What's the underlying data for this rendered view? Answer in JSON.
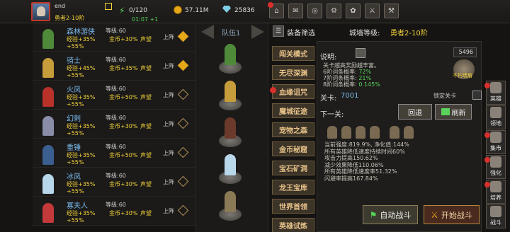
{
  "player": {
    "name": "end",
    "rank": "勇者2-10阶",
    "stamina": "0/120",
    "timer": "01:07 +1",
    "gold": "57.11M",
    "diamonds": "25836"
  },
  "top_buttons": [
    {
      "icon": "shop-icon",
      "glyph": "⌂",
      "dot": true
    },
    {
      "icon": "mail-icon",
      "glyph": "✉",
      "dot": false
    },
    {
      "icon": "gamepad-icon",
      "glyph": "◎",
      "dot": false
    },
    {
      "icon": "settings-icon",
      "glyph": "⚙",
      "dot": false
    },
    {
      "icon": "wheel-icon",
      "glyph": "✿",
      "dot": false
    },
    {
      "icon": "sword-icon",
      "glyph": "⚔",
      "dot": false
    },
    {
      "icon": "axe-icon",
      "glyph": "⚒",
      "dot": false
    }
  ],
  "heroes": [
    {
      "name": "森林游侠",
      "level": "等级:60",
      "exp": "经验+35%",
      "gold": "金币+30%",
      "fame": "声望",
      "extra": "+55%",
      "deploy": "上阵",
      "deployed": true,
      "color": "#4f8a3a"
    },
    {
      "name": "骑士",
      "level": "等级:60",
      "exp": "经验+45%",
      "gold": "金币+35%",
      "fame": "声望",
      "extra": "+55%",
      "deploy": "上阵",
      "deployed": true,
      "color": "#c79c3a"
    },
    {
      "name": "火凤",
      "level": "等级:60",
      "exp": "经验+35%",
      "gold": "金币+50%",
      "fame": "声望",
      "extra": "+55%",
      "deploy": "上阵",
      "deployed": false,
      "color": "#b8322a"
    },
    {
      "name": "幻刺",
      "level": "等级:60",
      "exp": "经验+35%",
      "gold": "金币+30%",
      "fame": "声望",
      "extra": "+55%",
      "deploy": "上阵",
      "deployed": false,
      "color": "#8a8ca8"
    },
    {
      "name": "重锤",
      "level": "等级:60",
      "exp": "经验+35%",
      "gold": "金币+50%",
      "fame": "声望",
      "extra": "+55%",
      "deploy": "上阵",
      "deployed": false,
      "color": "#3b5f8f"
    },
    {
      "name": "冰凤",
      "level": "等级:60",
      "exp": "经验+35%",
      "gold": "金币+30%",
      "fame": "声望",
      "extra": "+55%",
      "deploy": "上阵",
      "deployed": false,
      "color": "#b9d7ea"
    },
    {
      "name": "寡夫人",
      "level": "等级:60",
      "exp": "经验+35%",
      "gold": "金币+30%",
      "fame": "声望",
      "extra": "+55%",
      "deploy": "上阵",
      "deployed": false,
      "color": "#c43a3a"
    }
  ],
  "team": {
    "label": "队伍1",
    "slots": [
      "#4f8a3a",
      "#c79c3a",
      "#6b3a2a",
      "#b9d7ea",
      "#8a7a55"
    ]
  },
  "modes": [
    {
      "label": "闯关模式",
      "dot": false
    },
    {
      "label": "无尽深渊",
      "dot": false
    },
    {
      "label": "血缘诅咒",
      "dot": true
    },
    {
      "label": "魔城征途",
      "dot": false
    },
    {
      "label": "宠物之森",
      "dot": false
    },
    {
      "label": "金币秘窟",
      "dot": false
    },
    {
      "label": "宝石矿洞",
      "dot": false
    },
    {
      "label": "龙王宝库",
      "dot": false
    },
    {
      "label": "世界首领",
      "dot": false
    },
    {
      "label": "英雄试炼",
      "dot": false
    }
  ],
  "panel": {
    "filter_label": "装备筛选",
    "town_label": "城墙等级:",
    "town_rank": "勇者2-10阶",
    "desc_label": "说明:",
    "desc_lines": [
      {
        "text": "关卡越高奖励越丰富。",
        "hl": ""
      },
      {
        "text": "6阶词条概率: ",
        "hl": "72%"
      },
      {
        "text": "7阶词条概率: ",
        "hl": "21%"
      },
      {
        "text": "8阶词条概率: ",
        "hl": "0.145%"
      }
    ],
    "skull_count": "5496",
    "boss_label": "不朽墙盾",
    "level_label": "关卡:",
    "level_value": "7001",
    "lock_label": "锁定关卡",
    "next_label": "下一关:",
    "back_label": "回退",
    "refresh_label": "刷新",
    "enemy_lines": [
      "当前强度:819.9%, 净化值:144%",
      "所有英雄降低速度持续时间60%",
      "攻击力提高150.62%",
      "减少效果降低110.06%",
      "所有英雄降低速度率51.32%",
      "闪避率提高167.84%"
    ],
    "auto_label": "自动战斗",
    "start_label": "开始战斗"
  },
  "sidebar": [
    {
      "label": "英雄",
      "icon": "hero-icon",
      "dot": true
    },
    {
      "label": "领地",
      "icon": "territory-icon",
      "dot": false
    },
    {
      "label": "集市",
      "icon": "market-icon",
      "dot": true
    },
    {
      "label": "强化",
      "icon": "upgrade-icon",
      "dot": true
    },
    {
      "label": "培养",
      "icon": "train-icon",
      "dot": true
    },
    {
      "label": "战斗",
      "icon": "battle-icon",
      "dot": false
    }
  ]
}
